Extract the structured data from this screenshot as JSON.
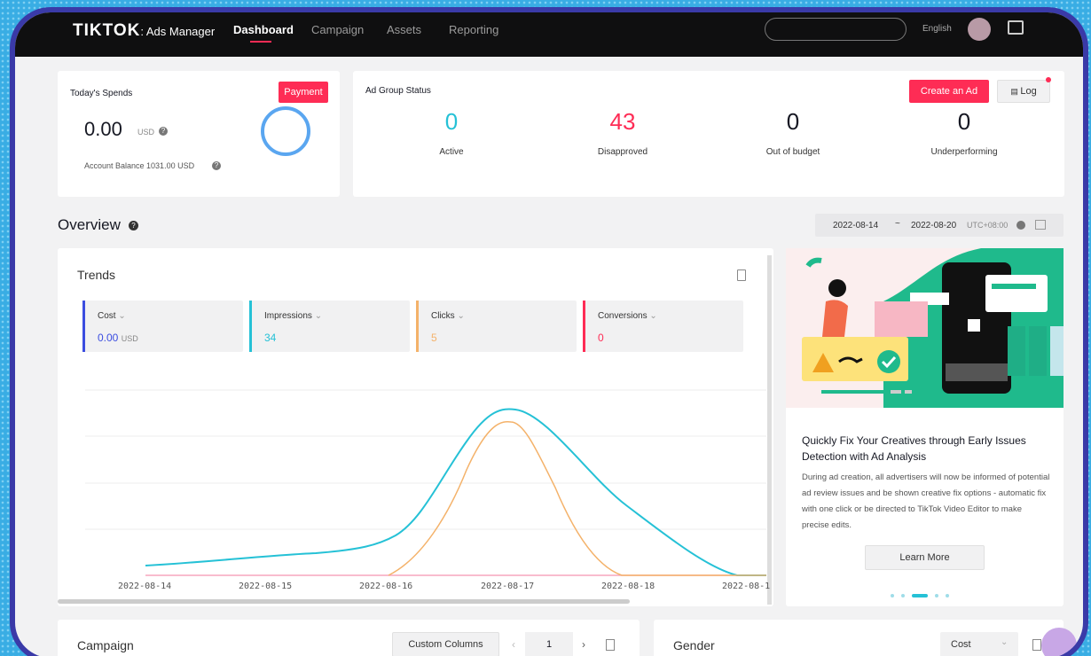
{
  "app": {
    "logo": "TIKTOK",
    "logo_sub": ": Ads Manager"
  },
  "nav": [
    {
      "label": "Dashboard"
    },
    {
      "label": "Campaign"
    },
    {
      "label": "Assets"
    },
    {
      "label": "Reporting"
    }
  ],
  "header": {
    "language": "English"
  },
  "spends": {
    "title": "Today's Spends",
    "payment_label": "Payment",
    "amount": "0.00",
    "currency": "USD",
    "balance": "Account Balance 1031.00 USD"
  },
  "ad_group_status": {
    "title": "Ad Group Status",
    "create_label": "Create an Ad",
    "log_label": "Log",
    "items": [
      {
        "value": "0",
        "label": "Active",
        "color": "#25c1d6"
      },
      {
        "value": "43",
        "label": "Disapproved",
        "color": "#fe2c55"
      },
      {
        "value": "0",
        "label": "Out of budget",
        "color": "#161823"
      },
      {
        "value": "0",
        "label": "Underperforming",
        "color": "#161823"
      }
    ]
  },
  "overview": {
    "title": "Overview",
    "date_start": "2022-08-14",
    "date_sep": "~",
    "date_end": "2022-08-20",
    "timezone": "UTC+08:00"
  },
  "trends": {
    "title": "Trends",
    "metrics": [
      {
        "name": "Cost",
        "value": "0.00",
        "unit": "USD",
        "color": "#3b4de0"
      },
      {
        "name": "Impressions",
        "value": "34",
        "unit": "",
        "color": "#25c1d6"
      },
      {
        "name": "Clicks",
        "value": "5",
        "unit": "",
        "color": "#f4b26a"
      },
      {
        "name": "Conversions",
        "value": "0",
        "unit": "",
        "color": "#fe2c55"
      }
    ],
    "dates": [
      "2022-08-14",
      "2022-08-15",
      "2022-08-16",
      "2022-08-17",
      "2022-08-18",
      "2022-08-1"
    ]
  },
  "promo": {
    "title": "Quickly Fix Your Creatives through Early Issues Detection with Ad Analysis",
    "body": "During ad creation, all advertisers will now be informed of potential ad review issues and be shown creative fix options - automatic fix with one click or be directed to TikTok Video Editor to make precise edits.",
    "button": "Learn More"
  },
  "campaign": {
    "title": "Campaign",
    "columns_label": "Custom Columns",
    "page": "1"
  },
  "gender": {
    "title": "Gender",
    "select_value": "Cost"
  }
}
